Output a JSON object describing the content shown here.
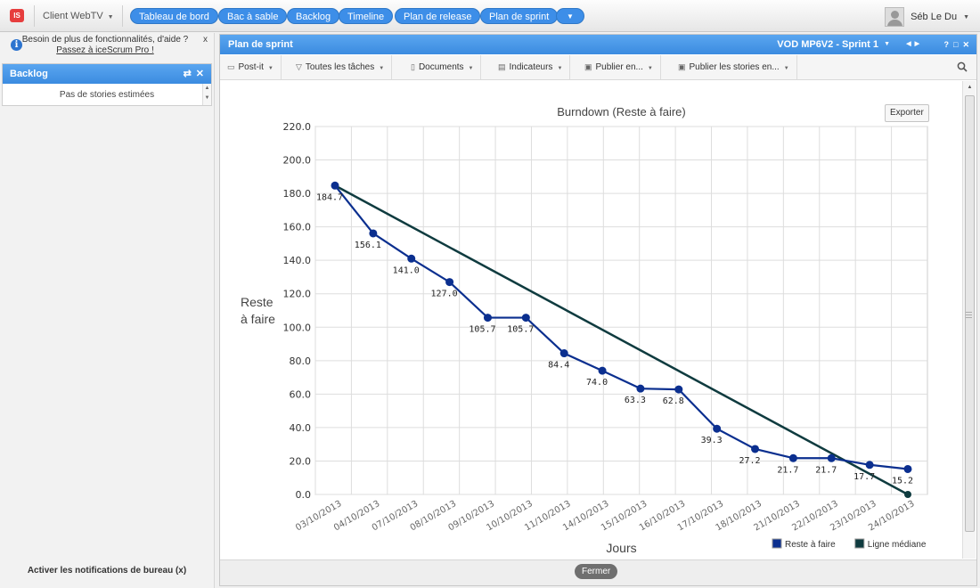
{
  "topbar": {
    "logo_text": "IS",
    "project_label": "Client WebTV",
    "menu": [
      {
        "label": "Tableau de bord"
      },
      {
        "label": "Bac à sable"
      },
      {
        "label": "Backlog"
      },
      {
        "label": "Timeline"
      },
      {
        "label": "Plan de release"
      },
      {
        "label": "Plan de sprint"
      }
    ],
    "more_icon": "caret-down-icon",
    "user_name": "Séb Le Du"
  },
  "left": {
    "help_text": "Besoin de plus de fonctionnalités, d'aide ?",
    "help_link": "Passez à iceScrum Pro !",
    "backlog_title": "Backlog",
    "backlog_empty": "Pas de stories estimées",
    "notifications": "Activer les notifications de bureau (x)"
  },
  "main": {
    "title": "Plan de sprint",
    "sprint_label": "VOD MP6V2 - Sprint 1",
    "toolbar": [
      {
        "label": "Post-it",
        "icon": "postit-icon"
      },
      {
        "label": "Toutes les tâches",
        "icon": "filter-icon"
      },
      {
        "label": "Documents",
        "icon": "document-icon"
      },
      {
        "label": "Indicateurs",
        "icon": "chart-icon"
      },
      {
        "label": "Publier en...",
        "icon": "print-icon"
      },
      {
        "label": "Publier les stories en...",
        "icon": "print-icon"
      }
    ],
    "export_label": "Exporter",
    "close_label": "Fermer"
  },
  "colors": {
    "accent": "#3d8ee8",
    "remaining": "#0b2f8f",
    "ideal": "#0f3b3f"
  },
  "chart_data": {
    "type": "line",
    "title": "Burndown (Reste à faire)",
    "xlabel": "Jours",
    "ylabel_lines": [
      "Reste",
      "à faire"
    ],
    "ylim": [
      0,
      220
    ],
    "ytick_step": 20,
    "grid": true,
    "legend_position": "bottom-right",
    "categories": [
      "03/10/2013",
      "04/10/2013",
      "07/10/2013",
      "08/10/2013",
      "09/10/2013",
      "10/10/2013",
      "11/10/2013",
      "14/10/2013",
      "15/10/2013",
      "16/10/2013",
      "17/10/2013",
      "18/10/2013",
      "21/10/2013",
      "22/10/2013",
      "23/10/2013",
      "24/10/2013"
    ],
    "series": [
      {
        "name": "Reste à faire",
        "values": [
          184.7,
          156.1,
          141.0,
          127.0,
          105.7,
          105.7,
          84.4,
          74.0,
          63.3,
          62.8,
          39.3,
          27.2,
          21.7,
          21.7,
          17.7,
          15.2
        ],
        "show_labels": true
      },
      {
        "name": "Ligne médiane",
        "values": [
          184.7,
          null,
          null,
          null,
          null,
          null,
          null,
          null,
          null,
          null,
          null,
          null,
          null,
          null,
          null,
          0
        ],
        "show_labels": false
      }
    ]
  }
}
